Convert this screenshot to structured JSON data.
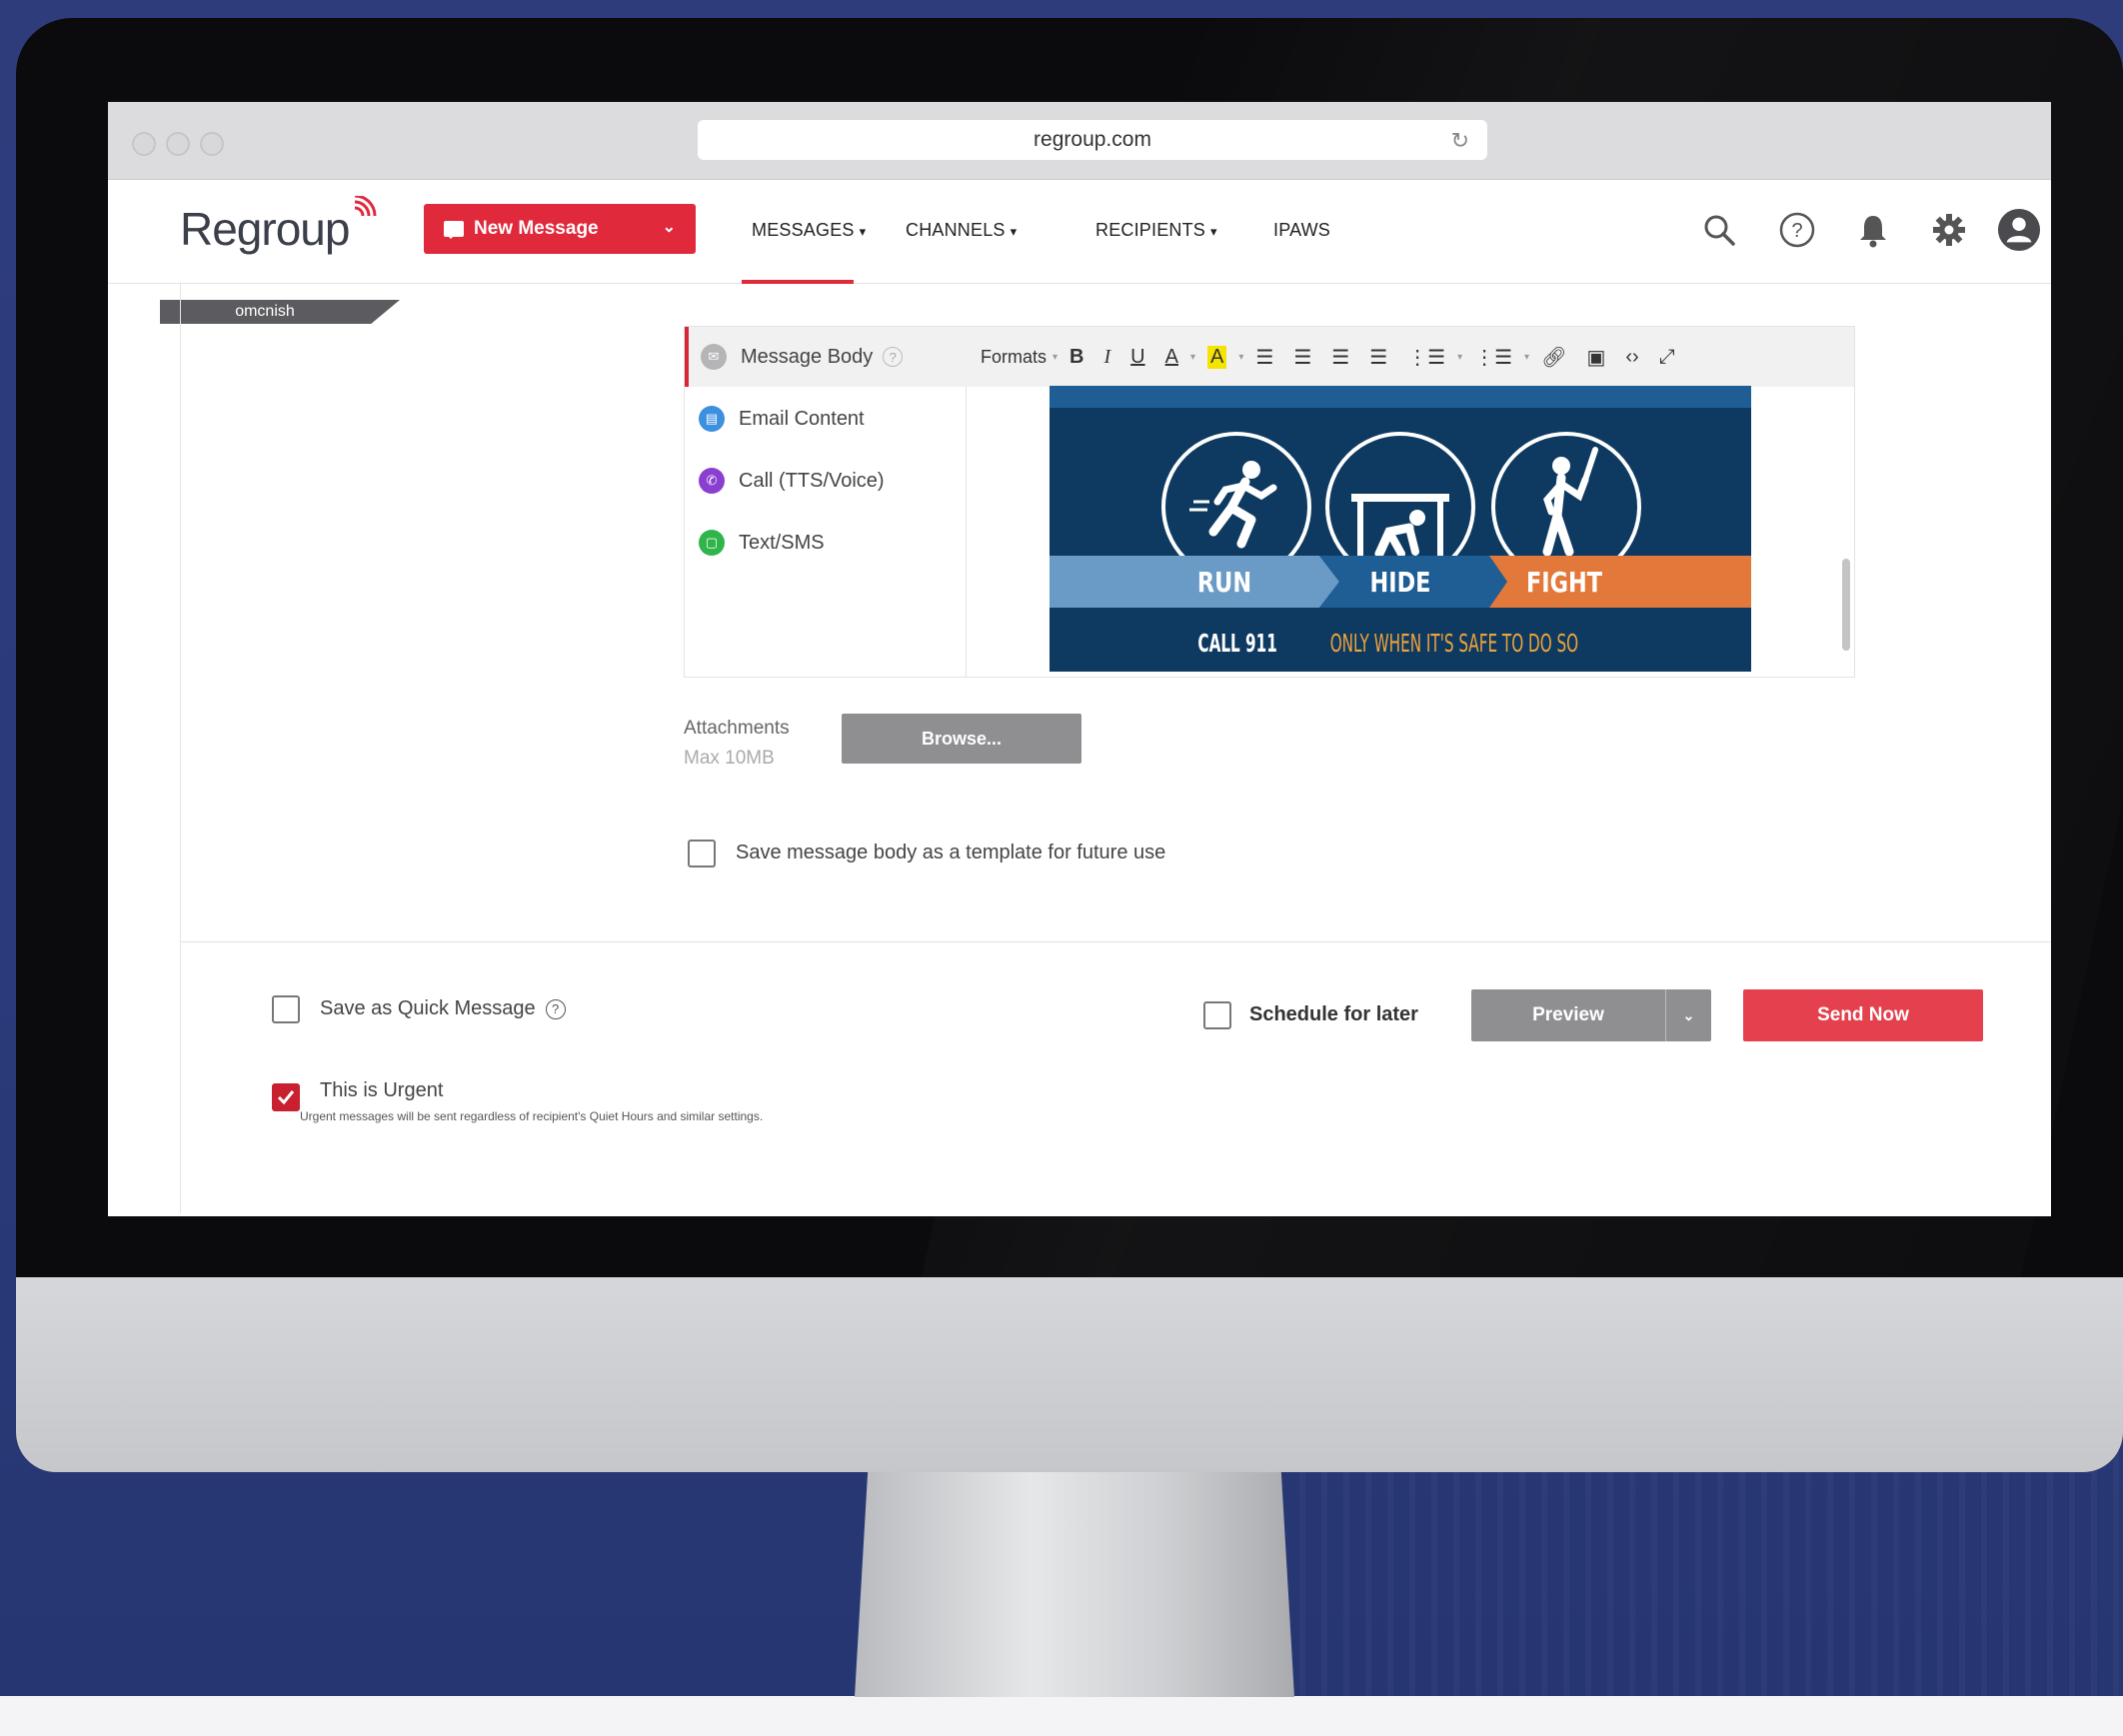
{
  "browser": {
    "url": "regroup.com",
    "reload_icon": "reload-icon"
  },
  "brand": {
    "logo_text": "Regroup",
    "accent_color": "#e0293b"
  },
  "header": {
    "new_message_label": "New Message",
    "nav": [
      {
        "label": "MESSAGES",
        "has_dropdown": true,
        "active": true
      },
      {
        "label": "CHANNELS",
        "has_dropdown": true,
        "active": false
      },
      {
        "label": "RECIPIENTS",
        "has_dropdown": true,
        "active": false
      },
      {
        "label": "IPAWS",
        "has_dropdown": false,
        "active": false
      }
    ],
    "icons": [
      "search-icon",
      "help-icon",
      "bell-icon",
      "gear-icon",
      "user-avatar-icon"
    ]
  },
  "user_tag": "omcnish",
  "editor": {
    "channels": [
      {
        "label": "Message Body",
        "icon": "envelope-icon",
        "active": true,
        "color": "#b5b5b8"
      },
      {
        "label": "Email Content",
        "icon": "email-icon",
        "active": false,
        "color": "#3d8fe0"
      },
      {
        "label": "Call (TTS/Voice)",
        "icon": "phone-icon",
        "active": false,
        "color": "#8a3fd1"
      },
      {
        "label": "Text/SMS",
        "icon": "sms-icon",
        "active": false,
        "color": "#2fb54a"
      }
    ],
    "toolbar": {
      "formats_label": "Formats",
      "buttons": [
        "bold",
        "italic",
        "underline",
        "font-color",
        "highlight",
        "align-left",
        "align-center",
        "align-right",
        "justify",
        "bullet-list",
        "numbered-list",
        "link",
        "image",
        "code",
        "fullscreen"
      ]
    },
    "poster": {
      "steps": [
        "RUN",
        "HIDE",
        "FIGHT"
      ],
      "footer_prefix": "CALL 911",
      "footer_suffix": "ONLY WHEN IT'S SAFE TO DO SO",
      "colors": {
        "navy": "#0e3a61",
        "light": "#6a9bc7",
        "mid": "#1e5e95",
        "orange": "#e2793a"
      }
    }
  },
  "attachments": {
    "label": "Attachments",
    "limit": "Max 10MB",
    "browse_label": "Browse..."
  },
  "save_template": {
    "label": "Save message body as a template for future use",
    "checked": false
  },
  "footer": {
    "quick_message_label": "Save as Quick Message",
    "quick_message_checked": false,
    "urgent_label": "This is Urgent",
    "urgent_note": "Urgent messages will be sent regardless of recipient's Quiet Hours and similar settings.",
    "urgent_checked": true,
    "schedule_label": "Schedule for later",
    "schedule_checked": false,
    "preview_label": "Preview",
    "send_label": "Send Now"
  }
}
